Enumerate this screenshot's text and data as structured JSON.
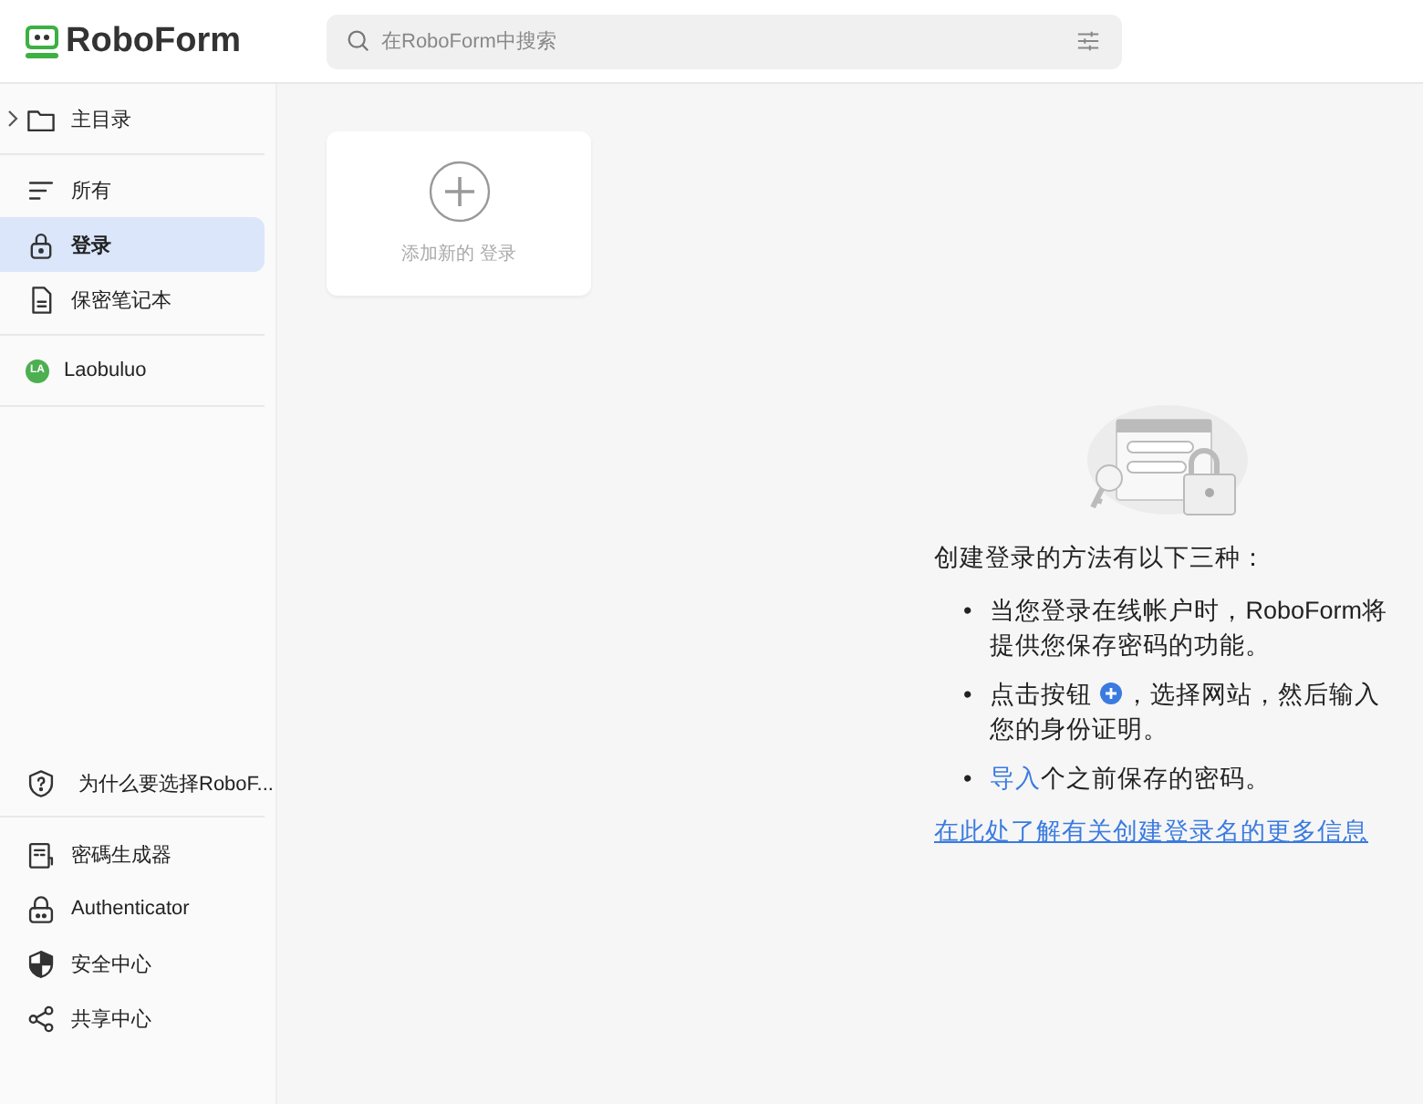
{
  "header": {
    "logo": "RoboForm",
    "search": {
      "placeholder": "在RoboForm中搜索"
    }
  },
  "sidebar": {
    "folder": {
      "label": "主目录",
      "expanded": false
    },
    "items": [
      {
        "kind": "all",
        "label": "所有",
        "selected": false
      },
      {
        "kind": "login",
        "label": "登录",
        "selected": true
      },
      {
        "kind": "note",
        "label": "保密笔记本",
        "selected": false
      }
    ],
    "account": {
      "initials": "LA",
      "name": "Laobuluo",
      "color": "#4caf50"
    },
    "promo": "为什么要选择RoboF...",
    "tools": [
      {
        "kind": "generator",
        "label": "密碼生成器"
      },
      {
        "kind": "authenticator",
        "label": "Authenticator"
      },
      {
        "kind": "security",
        "label": "安全中心"
      },
      {
        "kind": "sharing",
        "label": "共享中心"
      }
    ]
  },
  "add_card": {
    "label": "添加新的 登录"
  },
  "info": {
    "heading": "创建登录的方法有以下三种：",
    "bullets": [
      {
        "marker": "•",
        "parts": [
          {
            "kind": "text",
            "text": "当您登录在线帐户时，RoboForm将提供您保存密码的功能。"
          }
        ]
      },
      {
        "marker": "•",
        "parts": [
          {
            "kind": "text",
            "text": "点击按钮"
          },
          {
            "kind": "icon"
          },
          {
            "kind": "text",
            "text": "，选择网站，然后输入您的身份证明。"
          }
        ]
      },
      {
        "marker": "•",
        "parts": [
          {
            "kind": "link",
            "text": "导入"
          },
          {
            "kind": "text",
            "text": "个之前保存的密码。"
          }
        ]
      }
    ],
    "link": "在此处了解有关创建登录名的更多信息"
  }
}
